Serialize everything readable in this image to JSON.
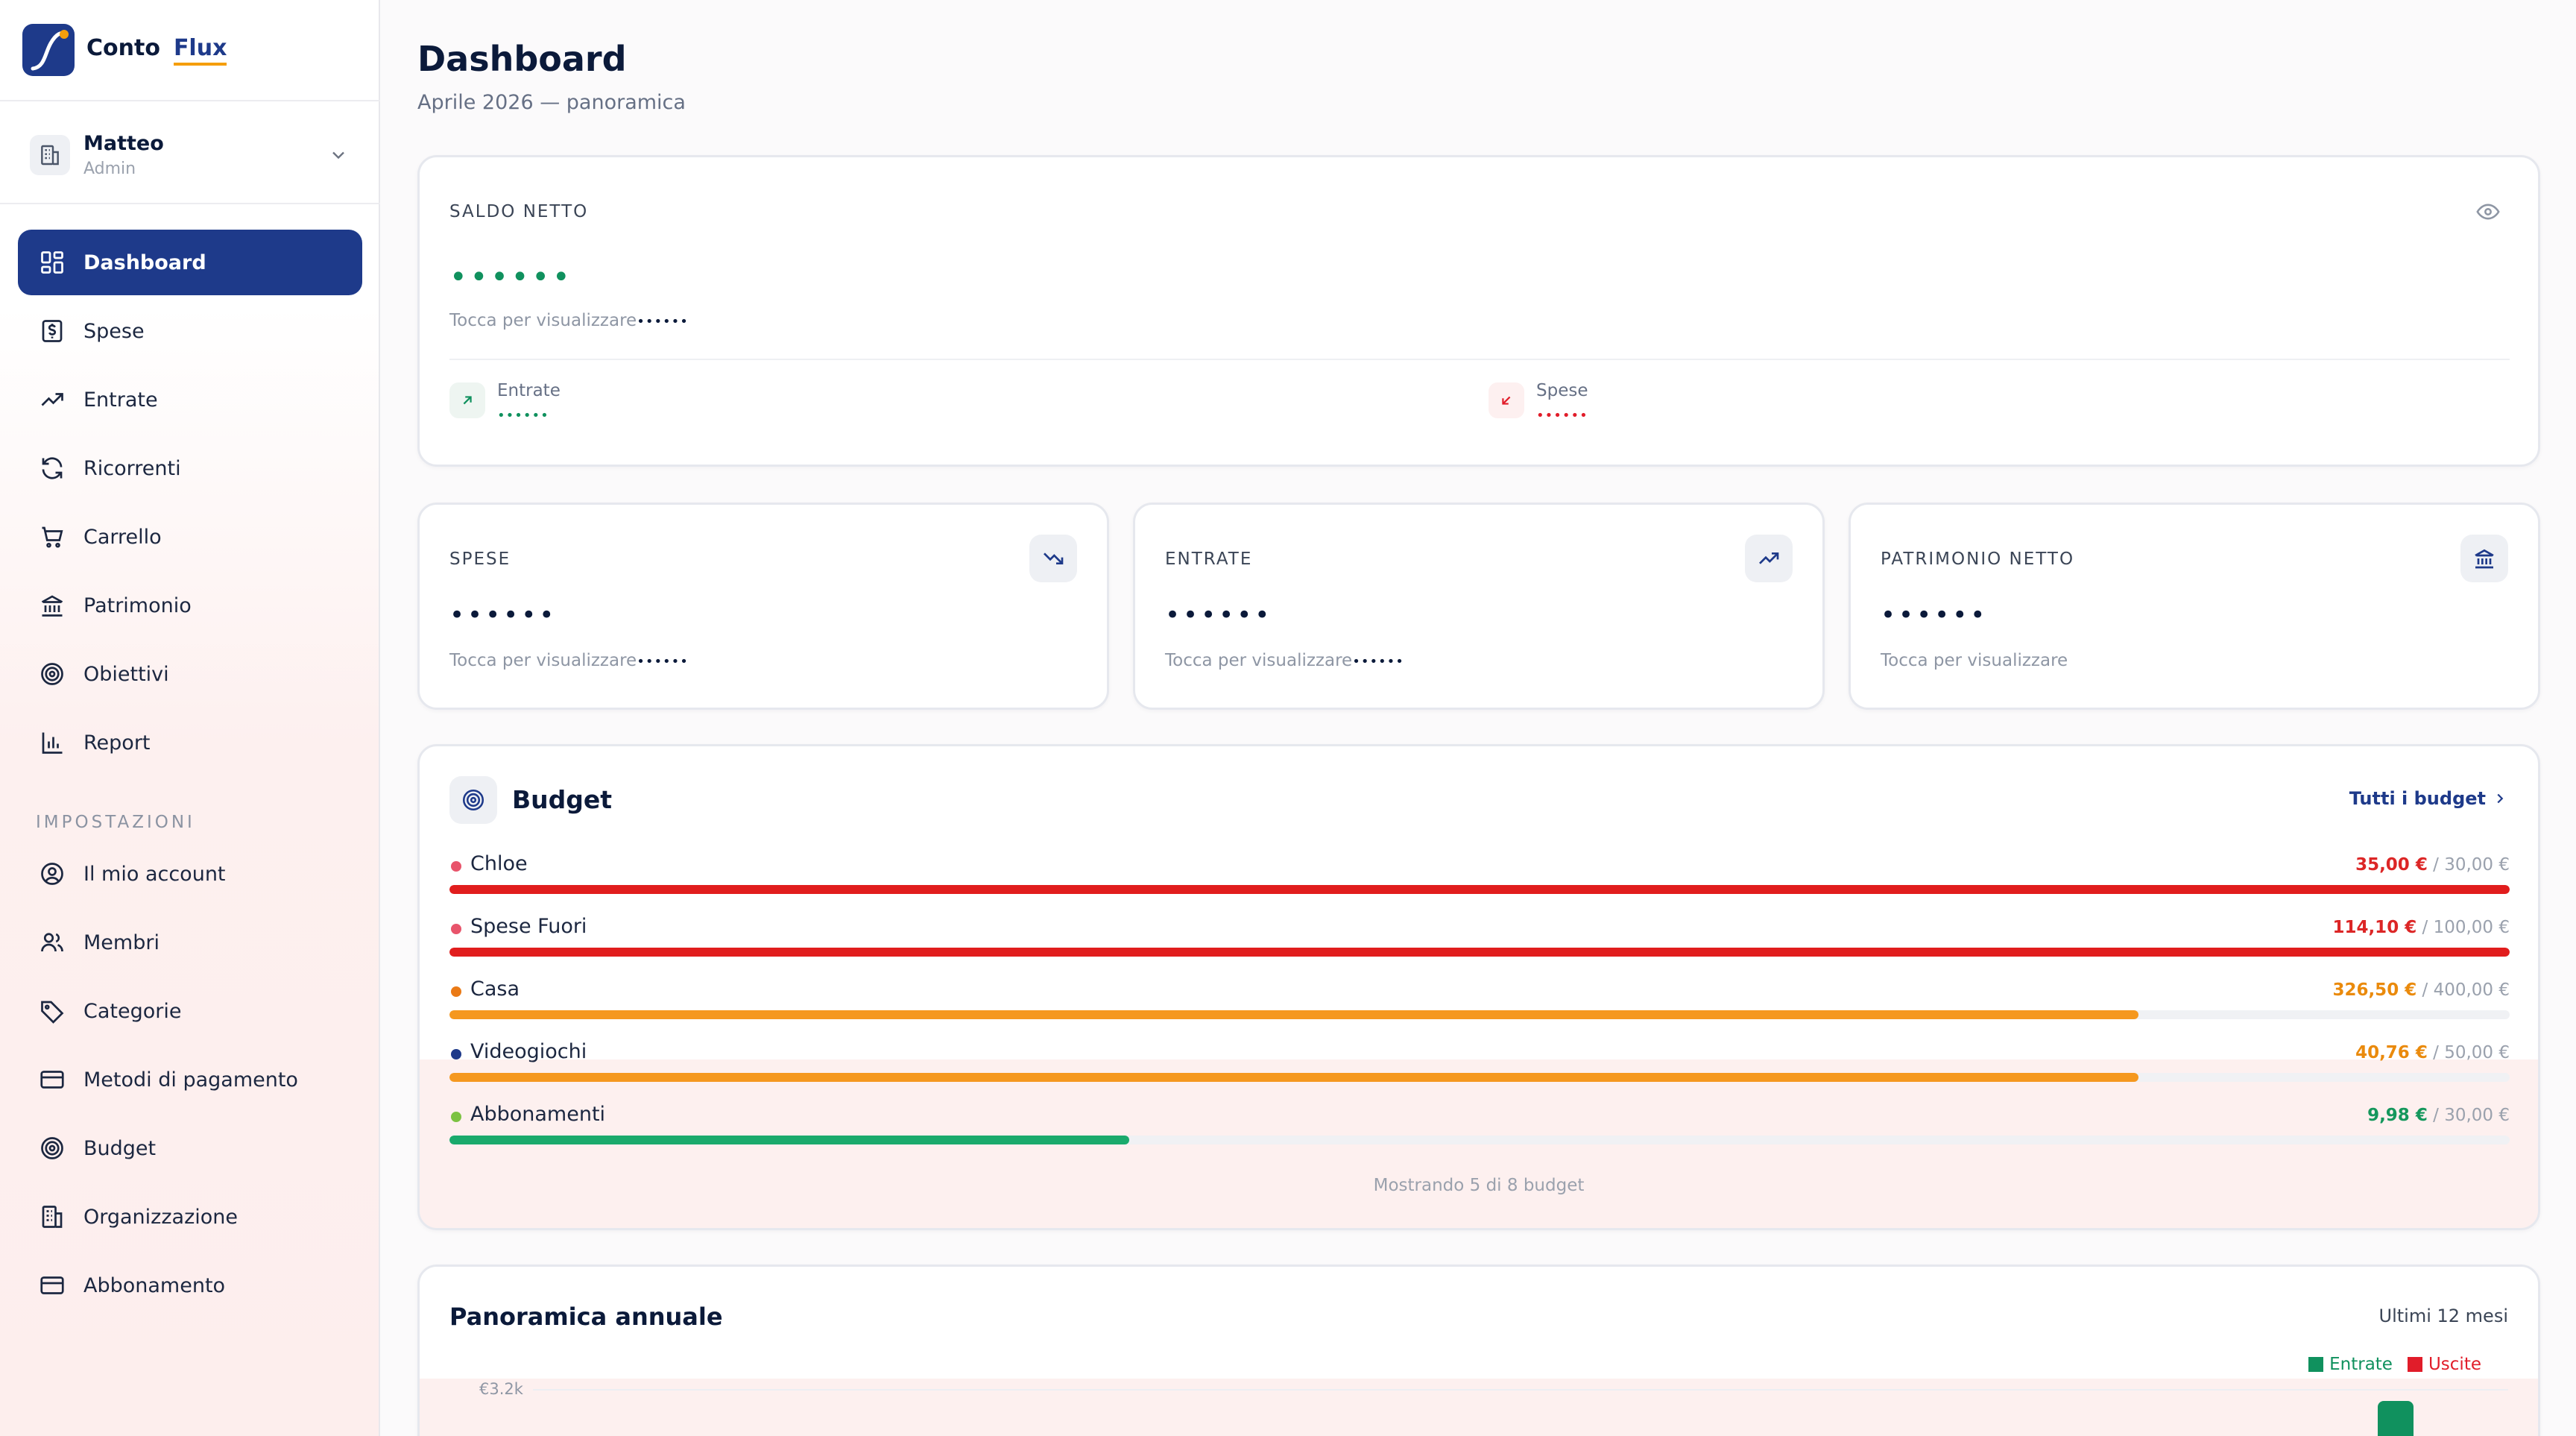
{
  "app": {
    "logo_part1": "Conto",
    "logo_part2": "Flux"
  },
  "org": {
    "name": "Matteo",
    "role": "Admin"
  },
  "nav": {
    "items": [
      {
        "label": "Dashboard",
        "icon": "grid-icon",
        "active": true
      },
      {
        "label": "Spese",
        "icon": "dollar-receipt-icon"
      },
      {
        "label": "Entrate",
        "icon": "trending-up-icon"
      },
      {
        "label": "Ricorrenti",
        "icon": "refresh-icon"
      },
      {
        "label": "Carrello",
        "icon": "cart-icon"
      },
      {
        "label": "Patrimonio",
        "icon": "bank-icon"
      },
      {
        "label": "Obiettivi",
        "icon": "target-icon"
      },
      {
        "label": "Report",
        "icon": "bar-chart-icon"
      }
    ],
    "settings_title": "IMPOSTAZIONI",
    "settings": [
      {
        "label": "Il mio account",
        "icon": "user-circle-icon"
      },
      {
        "label": "Membri",
        "icon": "users-icon"
      },
      {
        "label": "Categorie",
        "icon": "tag-icon"
      },
      {
        "label": "Metodi di pagamento",
        "icon": "credit-card-icon"
      },
      {
        "label": "Budget",
        "icon": "target-icon"
      },
      {
        "label": "Organizzazione",
        "icon": "building-icon"
      },
      {
        "label": "Abbonamento",
        "icon": "credit-card-icon"
      }
    ]
  },
  "header": {
    "title": "Dashboard",
    "subtitle": "Aprile 2026 — panoramica"
  },
  "net_balance": {
    "label": "SALDO NETTO",
    "masked": "••••••",
    "hint": "Tocca per visualizzare",
    "hint_masked": "••••••",
    "income_label": "Entrate",
    "income_masked": "••••••",
    "expense_label": "Spese",
    "expense_masked": "••••••"
  },
  "stat_cards": [
    {
      "label": "SPESE",
      "masked": "••••••",
      "hint": "Tocca per visualizzare",
      "hint_masked": "••••••",
      "icon": "trending-down-icon"
    },
    {
      "label": "ENTRATE",
      "masked": "••••••",
      "hint": "Tocca per visualizzare",
      "hint_masked": "••••••",
      "icon": "trending-up-icon"
    },
    {
      "label": "PATRIMONIO NETTO",
      "masked": "••••••",
      "hint": "Tocca per visualizzare",
      "hint_masked": "",
      "icon": "bank-icon"
    }
  ],
  "budget": {
    "title": "Budget",
    "all_link": "Tutti i budget",
    "footer": "Mostrando 5 di 8 budget",
    "rows": [
      {
        "name": "Chloe",
        "spent": "35,00 €",
        "limit": "/ 30,00 €",
        "progress": 1.0,
        "dot_color": "#e8546b",
        "bar_color": "#e11d1d",
        "amount_color": "#dc2626"
      },
      {
        "name": "Spese Fuori",
        "spent": "114,10 €",
        "limit": "/ 100,00 €",
        "progress": 1.0,
        "dot_color": "#e8546b",
        "bar_color": "#e11d1d",
        "amount_color": "#dc2626"
      },
      {
        "name": "Casa",
        "spent": "326,50 €",
        "limit": "/ 400,00 €",
        "progress": 0.82,
        "dot_color": "#ea7a16",
        "bar_color": "#f5981f",
        "amount_color": "#ea8a0c"
      },
      {
        "name": "Videogiochi",
        "spent": "40,76 €",
        "limit": "/ 50,00 €",
        "progress": 0.82,
        "dot_color": "#1e3a8a",
        "bar_color": "#f5981f",
        "amount_color": "#ea8a0c"
      },
      {
        "name": "Abbonamenti",
        "spent": "9,98 €",
        "limit": "/ 30,00 €",
        "progress": 0.33,
        "dot_color": "#7cc242",
        "bar_color": "#1aaa6c",
        "amount_color": "#14975c"
      }
    ]
  },
  "annual": {
    "title": "Panoramica annuale",
    "range": "Ultimi 12 mesi",
    "legend_income": "Entrate",
    "legend_expense": "Uscite",
    "colors": {
      "income": "#10915e",
      "expense": "#e11d2a"
    }
  },
  "chart_data": {
    "type": "bar",
    "title": "Panoramica annuale",
    "series": [
      {
        "name": "Entrate",
        "values": []
      },
      {
        "name": "Uscite",
        "values": []
      }
    ],
    "y_tick_labels": [
      "€3.2k"
    ],
    "legend": "top-right"
  }
}
